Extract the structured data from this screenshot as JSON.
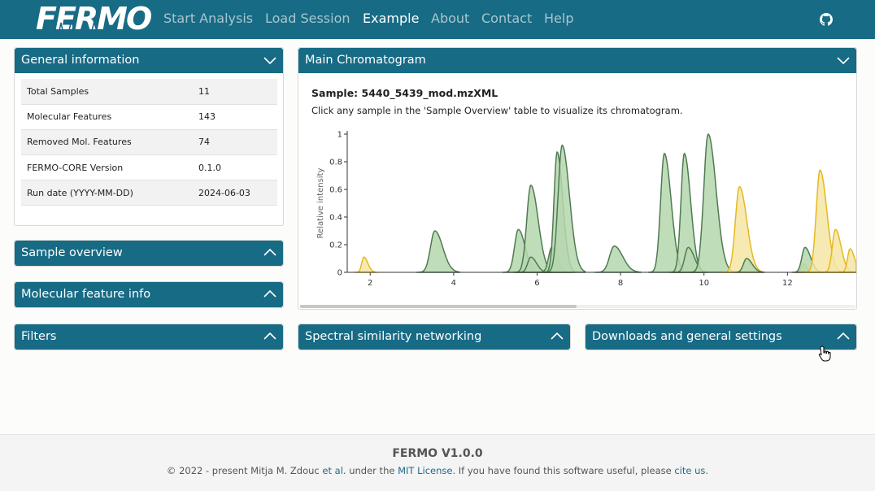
{
  "nav": {
    "brand": "FERMO",
    "links": [
      "Start Analysis",
      "Load Session",
      "Example",
      "About",
      "Contact",
      "Help"
    ],
    "active": "Example",
    "github_icon": "github-icon"
  },
  "general_info": {
    "title": "General information",
    "rows": [
      {
        "label": "Total Samples",
        "value": "11"
      },
      {
        "label": "Molecular Features",
        "value": "143"
      },
      {
        "label": "Removed Mol. Features",
        "value": "74"
      },
      {
        "label": "FERMO-CORE Version",
        "value": "0.1.0"
      },
      {
        "label": "Run date (YYYY-MM-DD)",
        "value": "2024-06-03"
      }
    ]
  },
  "panels": {
    "sample_overview": "Sample overview",
    "molecular_feature_info": "Molecular feature info",
    "filters": "Filters",
    "spectral_networking": "Spectral similarity networking",
    "downloads": "Downloads and general settings"
  },
  "chromatogram": {
    "title": "Main Chromatogram",
    "sample_label": "Sample: 5440_5439_mod.mzXML",
    "hint": "Click any sample in the 'Sample Overview' table to visualize its chromatogram."
  },
  "chart_data": {
    "type": "area",
    "ylabel": "Relative intensity",
    "xlabel": "",
    "xlim": [
      1.45,
      13.65
    ],
    "ylim": [
      0,
      1
    ],
    "x_ticks": [
      2,
      4,
      6,
      8,
      10,
      12
    ],
    "y_ticks": [
      0,
      0.2,
      0.4,
      0.6,
      0.8,
      1
    ],
    "y_tick_labels": [
      "0",
      "0.2",
      "0.4",
      "0.6",
      "0.8",
      "1"
    ],
    "colors": {
      "green_fill": "#b5d7ae",
      "green_line": "#4f7a52",
      "yellow_fill": "#f4e6a4",
      "yellow_line": "#e6b820"
    },
    "peaks": [
      {
        "rt": 1.85,
        "h": 0.11,
        "w": 0.07,
        "color": "yellow"
      },
      {
        "rt": 3.55,
        "h": 0.3,
        "w": 0.14,
        "color": "green"
      },
      {
        "rt": 5.55,
        "h": 0.31,
        "w": 0.12,
        "color": "green"
      },
      {
        "rt": 5.85,
        "h": 0.63,
        "w": 0.13,
        "color": "green"
      },
      {
        "rt": 5.85,
        "h": 0.11,
        "w": 0.1,
        "color": "green"
      },
      {
        "rt": 6.35,
        "h": 0.18,
        "w": 0.1,
        "color": "green"
      },
      {
        "rt": 6.48,
        "h": 0.87,
        "w": 0.1,
        "color": "green"
      },
      {
        "rt": 6.6,
        "h": 0.92,
        "w": 0.13,
        "color": "green"
      },
      {
        "rt": 7.85,
        "h": 0.19,
        "w": 0.15,
        "color": "green"
      },
      {
        "rt": 9.05,
        "h": 0.86,
        "w": 0.12,
        "color": "green"
      },
      {
        "rt": 9.53,
        "h": 0.86,
        "w": 0.11,
        "color": "green"
      },
      {
        "rt": 9.62,
        "h": 0.18,
        "w": 0.11,
        "color": "green"
      },
      {
        "rt": 10.1,
        "h": 1.0,
        "w": 0.14,
        "color": "green"
      },
      {
        "rt": 10.85,
        "h": 0.62,
        "w": 0.13,
        "color": "yellow"
      },
      {
        "rt": 11.02,
        "h": 0.1,
        "w": 0.1,
        "color": "green"
      },
      {
        "rt": 12.38,
        "h": 0.06,
        "w": 0.06,
        "color": "yellow"
      },
      {
        "rt": 12.42,
        "h": 0.18,
        "w": 0.1,
        "color": "green"
      },
      {
        "rt": 12.78,
        "h": 0.74,
        "w": 0.12,
        "color": "yellow"
      },
      {
        "rt": 13.15,
        "h": 0.31,
        "w": 0.1,
        "color": "yellow"
      },
      {
        "rt": 13.5,
        "h": 0.17,
        "w": 0.08,
        "color": "yellow"
      }
    ]
  },
  "footer": {
    "title": "FERMO V1.0.0",
    "text_prefix": "© 2022 - present Mitja M. Zdouc ",
    "etal_link": "et al.",
    "text_mid": " under the ",
    "license_link": "MIT License",
    "text_mid2": ". If you have found this software useful, please ",
    "cite_link": "cite us",
    "text_suffix": "."
  }
}
